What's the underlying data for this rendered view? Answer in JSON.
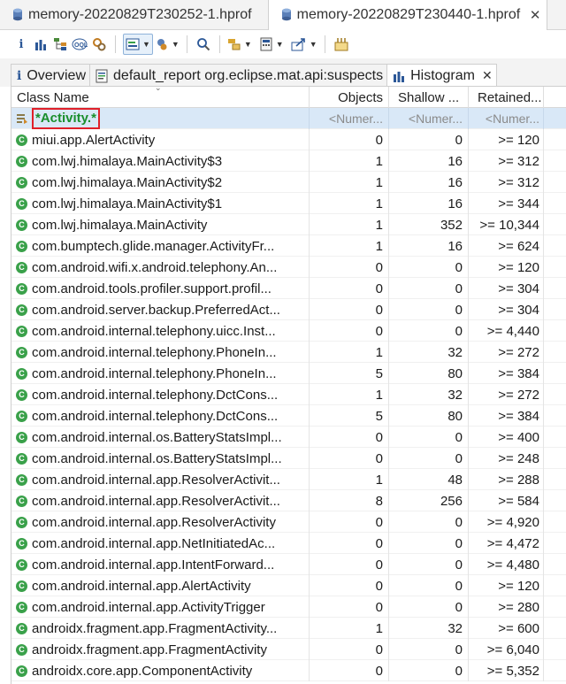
{
  "editor_tabs": [
    {
      "label": "memory-20220829T230252-1.hprof",
      "active": false
    },
    {
      "label": "memory-20220829T230440-1.hprof",
      "active": true
    }
  ],
  "close_glyph": "✕",
  "view_tabs": [
    {
      "label": "Overview",
      "icon": "info-icon"
    },
    {
      "label": "default_report  org.eclipse.mat.api:suspects",
      "icon": "report-icon"
    },
    {
      "label": "Histogram",
      "icon": "histogram-icon",
      "active": true
    }
  ],
  "columns": {
    "name": "Class Name",
    "objects": "Objects",
    "shallow": "Shallow ...",
    "retained": "Retained..."
  },
  "filter_row": {
    "name": "*Activity.*",
    "objects": "<Numer...",
    "shallow": "<Numer...",
    "retained": "<Numer..."
  },
  "rows": [
    {
      "name": "miui.app.AlertActivity",
      "objects": "0",
      "shallow": "0",
      "retained": ">= 120"
    },
    {
      "name": "com.lwj.himalaya.MainActivity$3",
      "objects": "1",
      "shallow": "16",
      "retained": ">= 312"
    },
    {
      "name": "com.lwj.himalaya.MainActivity$2",
      "objects": "1",
      "shallow": "16",
      "retained": ">= 312"
    },
    {
      "name": "com.lwj.himalaya.MainActivity$1",
      "objects": "1",
      "shallow": "16",
      "retained": ">= 344"
    },
    {
      "name": "com.lwj.himalaya.MainActivity",
      "objects": "1",
      "shallow": "352",
      "retained": ">= 10,344"
    },
    {
      "name": "com.bumptech.glide.manager.ActivityFr...",
      "objects": "1",
      "shallow": "16",
      "retained": ">= 624"
    },
    {
      "name": "com.android.wifi.x.android.telephony.An...",
      "objects": "0",
      "shallow": "0",
      "retained": ">= 120"
    },
    {
      "name": "com.android.tools.profiler.support.profil...",
      "objects": "0",
      "shallow": "0",
      "retained": ">= 304"
    },
    {
      "name": "com.android.server.backup.PreferredAct...",
      "objects": "0",
      "shallow": "0",
      "retained": ">= 304"
    },
    {
      "name": "com.android.internal.telephony.uicc.Inst...",
      "objects": "0",
      "shallow": "0",
      "retained": ">= 4,440"
    },
    {
      "name": "com.android.internal.telephony.PhoneIn...",
      "objects": "1",
      "shallow": "32",
      "retained": ">= 272"
    },
    {
      "name": "com.android.internal.telephony.PhoneIn...",
      "objects": "5",
      "shallow": "80",
      "retained": ">= 384"
    },
    {
      "name": "com.android.internal.telephony.DctCons...",
      "objects": "1",
      "shallow": "32",
      "retained": ">= 272"
    },
    {
      "name": "com.android.internal.telephony.DctCons...",
      "objects": "5",
      "shallow": "80",
      "retained": ">= 384"
    },
    {
      "name": "com.android.internal.os.BatteryStatsImpl...",
      "objects": "0",
      "shallow": "0",
      "retained": ">= 400"
    },
    {
      "name": "com.android.internal.os.BatteryStatsImpl...",
      "objects": "0",
      "shallow": "0",
      "retained": ">= 248"
    },
    {
      "name": "com.android.internal.app.ResolverActivit...",
      "objects": "1",
      "shallow": "48",
      "retained": ">= 288"
    },
    {
      "name": "com.android.internal.app.ResolverActivit...",
      "objects": "8",
      "shallow": "256",
      "retained": ">= 584"
    },
    {
      "name": "com.android.internal.app.ResolverActivity",
      "objects": "0",
      "shallow": "0",
      "retained": ">= 4,920"
    },
    {
      "name": "com.android.internal.app.NetInitiatedAc...",
      "objects": "0",
      "shallow": "0",
      "retained": ">= 4,472"
    },
    {
      "name": "com.android.internal.app.IntentForward...",
      "objects": "0",
      "shallow": "0",
      "retained": ">= 4,480"
    },
    {
      "name": "com.android.internal.app.AlertActivity",
      "objects": "0",
      "shallow": "0",
      "retained": ">= 120"
    },
    {
      "name": "com.android.internal.app.ActivityTrigger",
      "objects": "0",
      "shallow": "0",
      "retained": ">= 280"
    },
    {
      "name": "androidx.fragment.app.FragmentActivity...",
      "objects": "1",
      "shallow": "32",
      "retained": ">= 600"
    },
    {
      "name": "androidx.fragment.app.FragmentActivity",
      "objects": "0",
      "shallow": "0",
      "retained": ">= 6,040"
    },
    {
      "name": "androidx.core.app.ComponentActivity",
      "objects": "0",
      "shallow": "0",
      "retained": ">= 5,352"
    }
  ],
  "colors": {
    "filter_highlight": "#d9e8f7",
    "filter_box": "#e0202a",
    "filter_text": "#1a8f2c",
    "class_icon": "#3aa14a"
  }
}
